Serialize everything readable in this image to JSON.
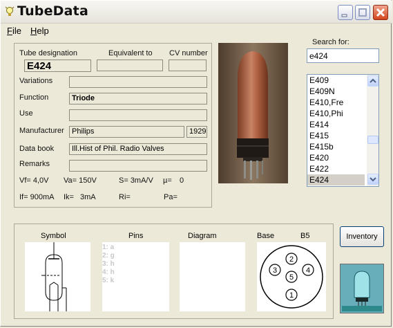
{
  "window": {
    "title": "TubeData"
  },
  "menu": [
    {
      "label": "File",
      "accel": "F"
    },
    {
      "label": "Help",
      "accel": "H"
    }
  ],
  "labels": {
    "tube_designation": "Tube designation",
    "equivalent_to": "Equivalent to",
    "cv_number": "CV number",
    "variations": "Variations",
    "function": "Function",
    "use": "Use",
    "manufacturer": "Manufacturer",
    "data_book": "Data book",
    "remarks": "Remarks",
    "search_for": "Search for:"
  },
  "fields": {
    "tube_designation": "E424",
    "equivalent_to": "",
    "cv_number": "",
    "variations": "",
    "function": "Triode",
    "use": "",
    "manufacturer": "Philips",
    "year": "1929",
    "data_book": "Ill.Hist of Phil. Radio Valves",
    "remarks": ""
  },
  "specs": {
    "vf": "Vf= 4,0V",
    "va": "Va= 150V",
    "s": "S= 3mA/V",
    "mu": "µ=",
    "mu_val": "0",
    "if": "If= 900mA",
    "ik": "Ik=",
    "ik_val": "3mA",
    "ri": "Ri=",
    "pa": "Pa="
  },
  "search": {
    "value": "e424"
  },
  "tube_list": {
    "items": [
      "E409",
      "E409N",
      "E410,Fre",
      "E410,Phi",
      "E414",
      "E415",
      "E415b",
      "E420",
      "E422",
      "E424"
    ],
    "selected": "E424"
  },
  "bottom": {
    "symbol": "Symbol",
    "pins": "Pins",
    "diagram": "Diagram",
    "base": "Base",
    "base_type": "B5",
    "pin_list": [
      "1: a",
      "2: g",
      "3: h",
      "4: h",
      "5: k"
    ],
    "base_pins": [
      "1",
      "2",
      "3",
      "4",
      "5"
    ]
  },
  "buttons": {
    "inventory": "Inventory"
  },
  "icons": [
    "lightbulb-icon",
    "minimize-icon",
    "maximize-icon",
    "close-icon",
    "scroll-up-icon",
    "scroll-down-icon"
  ]
}
